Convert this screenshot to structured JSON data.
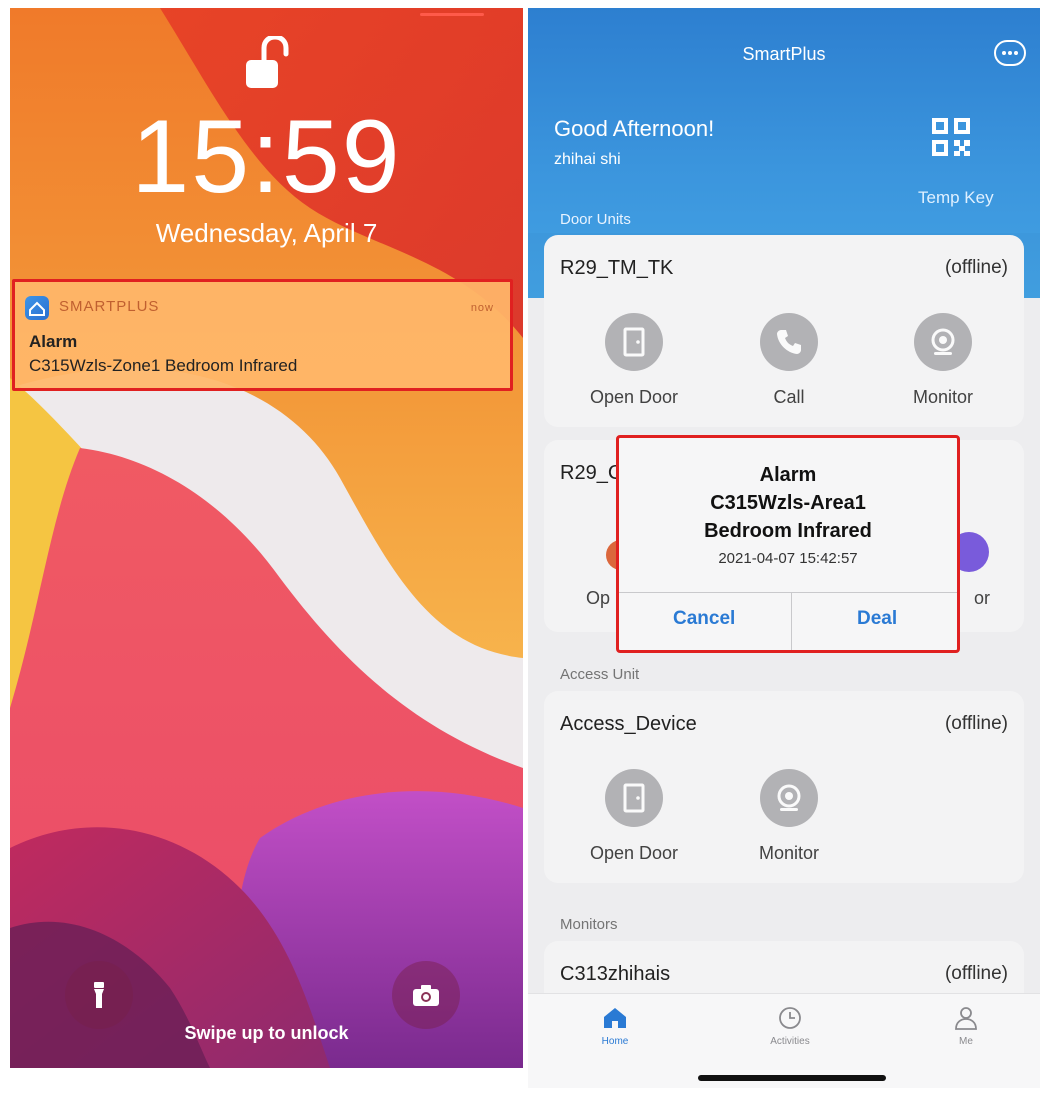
{
  "lock_screen": {
    "time": "15:59",
    "date": "Wednesday, April 7",
    "notification": {
      "app_name": "SMARTPLUS",
      "timestamp": "now",
      "title": "Alarm",
      "body": "C315Wzls-Zone1 Bedroom Infrared"
    },
    "swipe_hint": "Swipe up to unlock",
    "icons": [
      "unlocked-padlock-icon",
      "flashlight-icon",
      "camera-icon"
    ]
  },
  "app": {
    "title": "SmartPlus",
    "greeting": "Good Afternoon!",
    "user_name": "zhihai shi",
    "temp_key_label": "Temp Key",
    "sections": {
      "door_units": "Door Units",
      "access_unit": "Access Unit",
      "monitors": "Monitors"
    },
    "door_units": [
      {
        "name": "R29_TM_TK",
        "status": "(offline)",
        "controls": [
          "Open Door",
          "Call",
          "Monitor"
        ]
      },
      {
        "name_visible": "R29_C",
        "control_fragments": [
          "Op",
          "or"
        ]
      }
    ],
    "access_unit": {
      "name": "Access_Device",
      "status": "(offline)",
      "controls": [
        "Open Door",
        "Monitor"
      ]
    },
    "monitors": [
      {
        "name": "C313zhihais",
        "status": "(offline)"
      }
    ],
    "dialog": {
      "title_lines": [
        "Alarm",
        "C315Wzls-Area1",
        "Bedroom Infrared"
      ],
      "time": "2021-04-07 15:42:57",
      "cancel_label": "Cancel",
      "deal_label": "Deal"
    },
    "tabs": [
      {
        "label": "Home",
        "icon": "home-icon",
        "active": true
      },
      {
        "label": "Activities",
        "icon": "clock-icon",
        "active": false
      },
      {
        "label": "Me",
        "icon": "person-icon",
        "active": false
      }
    ]
  },
  "colors": {
    "alert_outline": "#e02020",
    "app_blue": "#2d7fd0",
    "button_blue": "#2a7ad4",
    "lock_orange": "#f07a2a"
  }
}
